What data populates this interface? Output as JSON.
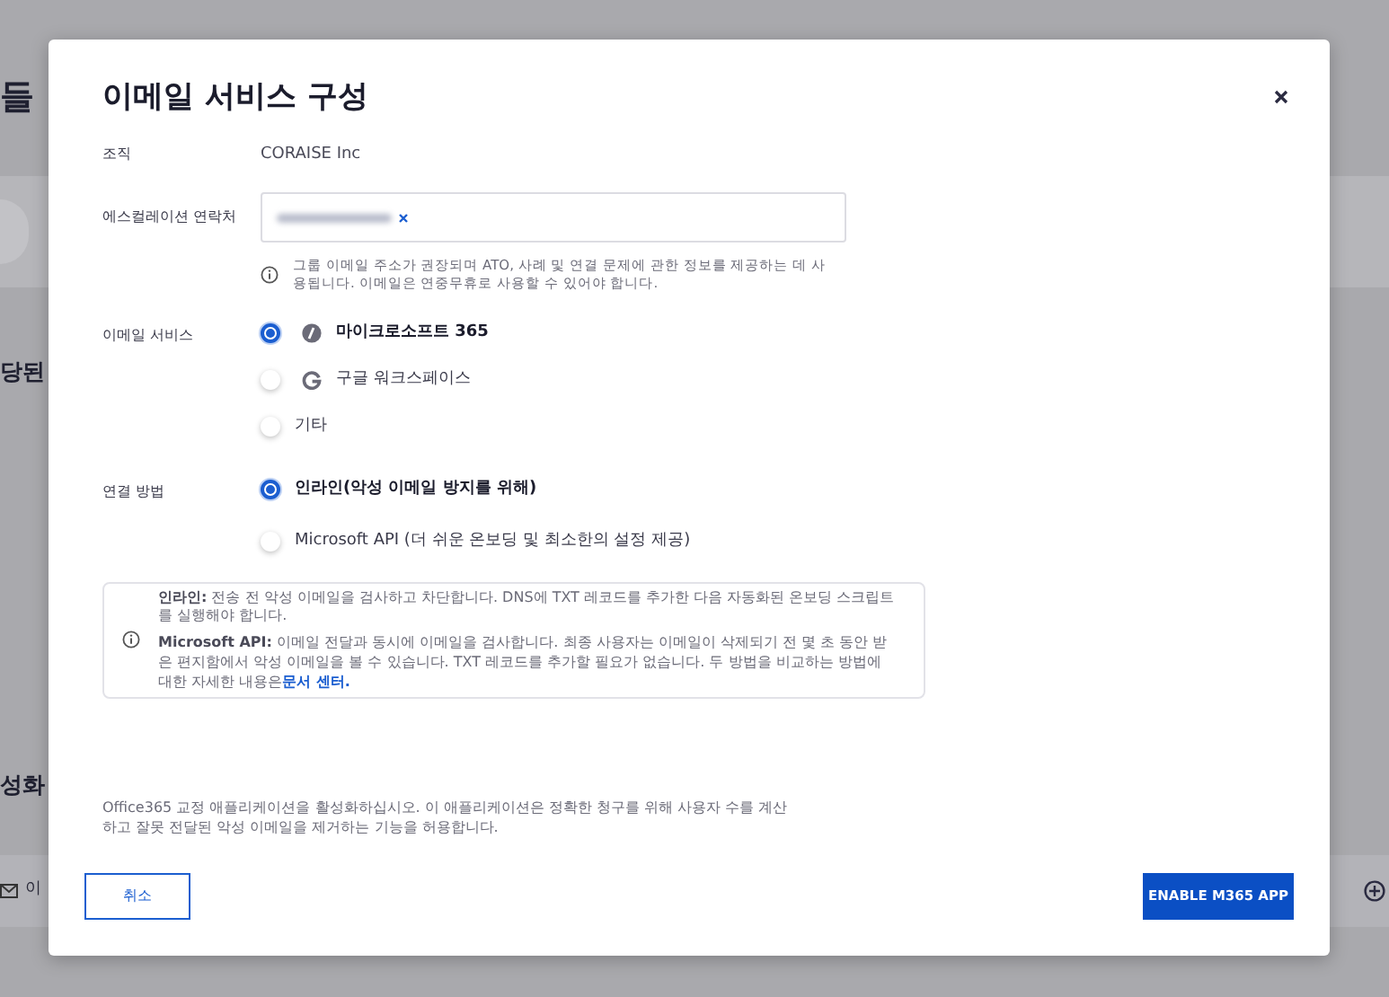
{
  "background": {
    "heading": "들",
    "section_1": "당된",
    "section_2": "성화",
    "row_label": "이"
  },
  "dialog": {
    "title": "이메일 서비스 구성",
    "organization": {
      "label": "조직",
      "value": "CORAISE Inc"
    },
    "escalation": {
      "label": "에스컬레이션 연락처",
      "contacts": [
        {
          "kind": "redacted"
        }
      ],
      "help": "그룹 이메일 주소가 권장되며 ATO, 사례 및 연결 문제에 관한 정보를 제공하는 데 사용됩니다. 이메일은 연중무휴로 사용할 수 있어야 합니다."
    },
    "email_service": {
      "label": "이메일 서비스",
      "options": [
        {
          "label": "마이크로소프트 365",
          "selected": true,
          "kind": "microsoft"
        },
        {
          "label": "구글 워크스페이스",
          "selected": false,
          "kind": "google"
        },
        {
          "label": "기타",
          "selected": false,
          "kind": "plain"
        }
      ]
    },
    "connection": {
      "label": "연결 방법",
      "options": [
        {
          "label": "인라인(악성 이메일 방지를 위해)",
          "selected": true
        },
        {
          "label": "Microsoft API (더 쉬운 온보딩 및 최소한의 설정 제공)",
          "selected": false
        }
      ]
    },
    "info": {
      "paragraphs": [
        "**인라인:** 전송 전 악성 이메일을 검사하고 차단합니다. DNS에 TXT 레코드를 추가한 다음 자동화된 온보딩 스크립트를 실행해야 합니다.",
        "**Microsoft API:** 이메일 전달과 동시에 이메일을 검사합니다. 최종 사용자는 이메일이 삭제되기 전 몇 초 동안 받은 편지함에서 악성 이메일을 볼 수 있습니다. TXT 레코드를 추가할 필요가 없습니다. 두 방법을 비교하는 방법에 대한 자세한 내용은"
      ],
      "link": "문서 센터."
    },
    "note": "Office365 교정 애플리케이션을 활성화하십시오. 이 애플리케이션은 정확한 청구를 위해 사용자 수를 계산하고 잘못 전달된 악성 이메일을 제거하는 기능을 허용합니다.",
    "buttons": {
      "cancel": "취소",
      "confirm": "ENABLE M365 APP"
    }
  }
}
